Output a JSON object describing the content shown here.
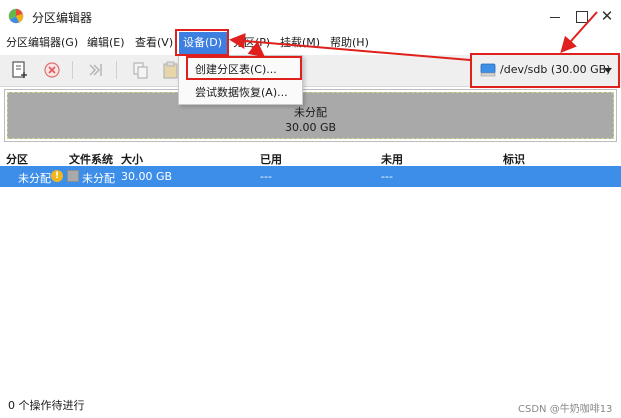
{
  "window": {
    "title": "分区编辑器",
    "icon": "gparted-app-icon"
  },
  "menubar": {
    "items": [
      {
        "label": "分区编辑器(G)"
      },
      {
        "label": "编辑(E)"
      },
      {
        "label": "查看(V)"
      },
      {
        "label": "设备(D)"
      },
      {
        "label": "分区(P)"
      },
      {
        "label": "挂载(M)"
      },
      {
        "label": "帮助(H)"
      }
    ]
  },
  "device_menu": {
    "items": [
      {
        "label": "创建分区表(C)..."
      },
      {
        "label": "尝试数据恢复(A)..."
      }
    ]
  },
  "toolbar": {
    "icons": [
      "new-partition-icon",
      "delete-icon",
      "resize-move-icon",
      "copy-icon",
      "paste-icon"
    ]
  },
  "device_selector": {
    "value": "/dev/sdb (30.00 GB)",
    "icon": "drive-icon"
  },
  "disk_map": {
    "label": "未分配",
    "size": "30.00 GB",
    "color": "#a9a9a9"
  },
  "table": {
    "headers": {
      "partition": "分区",
      "filesystem": "文件系统",
      "size": "大小",
      "used": "已用",
      "unused": "未用",
      "flags": "标识"
    },
    "rows": [
      {
        "partition": "未分配",
        "filesystem": "未分配",
        "size": "30.00 GB",
        "used": "---",
        "unused": "---",
        "flags": ""
      }
    ]
  },
  "status": {
    "text": "0 个操作待进行"
  },
  "watermark": {
    "text": "CSDN @牛奶咖啡13"
  },
  "colors": {
    "accent": "#3d8ee8",
    "annotation": "#e0201c",
    "unallocated": "#a9a9a9"
  }
}
